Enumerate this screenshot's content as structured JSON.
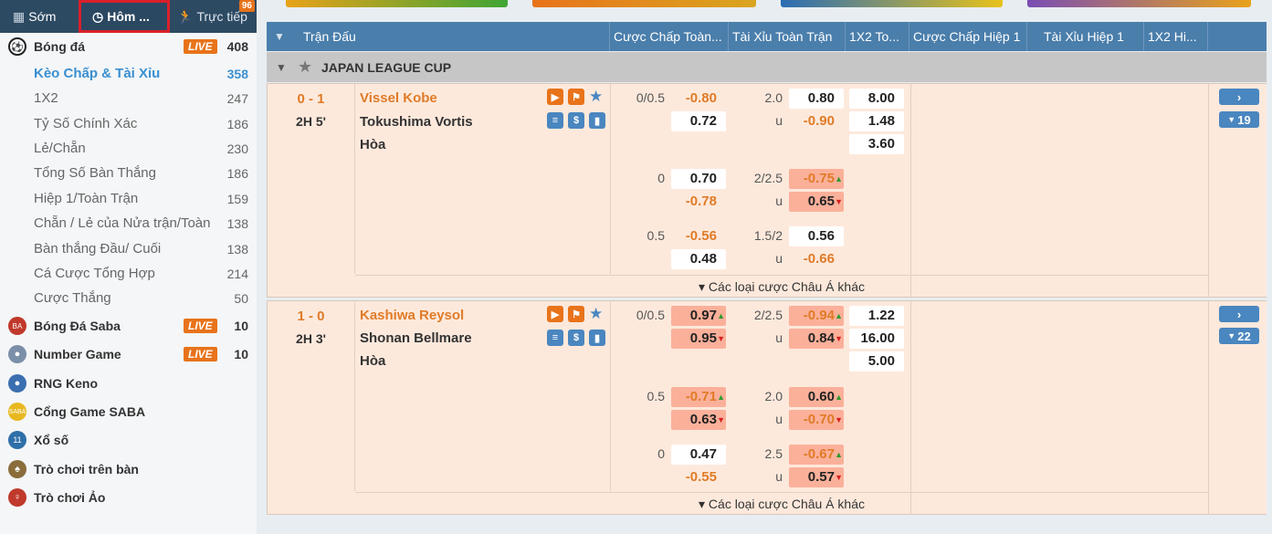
{
  "tabs": {
    "early": "Sớm",
    "today": "Hôm ...",
    "live": "Trực tiếp",
    "live_count": "96"
  },
  "sidebar": {
    "sports": [
      {
        "label": "Bóng đá",
        "live": "LIVE",
        "count": "408"
      },
      {
        "label": "Bóng Đá Saba",
        "live": "LIVE",
        "count": "10"
      },
      {
        "label": "Number Game",
        "live": "LIVE",
        "count": "10"
      },
      {
        "label": "RNG Keno"
      },
      {
        "label": "Cổng Game SABA"
      },
      {
        "label": "Xổ số"
      },
      {
        "label": "Trò chơi trên bàn"
      },
      {
        "label": "Trò chơi Ảo"
      }
    ],
    "subitems": [
      {
        "label": "Kèo Chấp & Tài Xỉu",
        "count": "358"
      },
      {
        "label": "1X2",
        "count": "247"
      },
      {
        "label": "Tỷ Số Chính Xác",
        "count": "186"
      },
      {
        "label": "Lẻ/Chẵn",
        "count": "230"
      },
      {
        "label": "Tổng Số Bàn Thắng",
        "count": "186"
      },
      {
        "label": "Hiệp 1/Toàn Trận",
        "count": "159"
      },
      {
        "label": "Chẵn / Lẻ của Nửa trận/Toàn",
        "count": "138"
      },
      {
        "label": "Bàn thắng Đầu/ Cuối",
        "count": "138"
      },
      {
        "label": "Cá Cược Tổng Hợp",
        "count": "214"
      },
      {
        "label": "Cược Thắng",
        "count": "50"
      }
    ]
  },
  "table": {
    "headers": [
      "Trận Đấu",
      "Cược Chấp Toàn...",
      "Tài Xỉu Toàn Trận",
      "1X2 To...",
      "Cược Chấp Hiệp 1",
      "Tài Xỉu Hiệp 1",
      "1X2 Hi..."
    ],
    "league": "JAPAN LEAGUE CUP",
    "more_label": "▾ Các loại cược Châu Á khác",
    "matches": [
      {
        "score": "0 - 1",
        "time": "2H 5'",
        "home": "Vissel Kobe",
        "away": "Tokushima Vortis",
        "draw": "Hòa",
        "more_count": "19",
        "x12": [
          "8.00",
          "1.48",
          "3.60"
        ],
        "lines": [
          {
            "hdp": "0/0.5",
            "h1": "-0.80",
            "h2": "0.72",
            "ou": "2.0",
            "o1": "0.80",
            "o2": "-0.90",
            "u": "u"
          },
          {
            "hdp": "0",
            "h1": "0.70",
            "h2": "-0.78",
            "ou": "2/2.5",
            "o1": "-0.75",
            "o2": "0.65",
            "u": "u"
          },
          {
            "hdp": "0.5",
            "h1": "-0.56",
            "h2": "0.48",
            "ou": "1.5/2",
            "o1": "0.56",
            "o2": "-0.66",
            "u": "u"
          }
        ]
      },
      {
        "score": "1 - 0",
        "time": "2H 3'",
        "home": "Kashiwa Reysol",
        "away": "Shonan Bellmare",
        "draw": "Hòa",
        "more_count": "22",
        "x12": [
          "1.22",
          "16.00",
          "5.00"
        ],
        "lines": [
          {
            "hdp": "0/0.5",
            "h1": "0.97",
            "h2": "0.95",
            "ou": "2/2.5",
            "o1": "-0.94",
            "o2": "0.84",
            "u": "u"
          },
          {
            "hdp": "0.5",
            "h1": "-0.71",
            "h2": "0.63",
            "ou": "2.0",
            "o1": "0.60",
            "o2": "-0.70",
            "u": "u"
          },
          {
            "hdp": "0",
            "h1": "0.47",
            "h2": "-0.55",
            "ou": "2.5",
            "o1": "-0.67",
            "o2": "0.57",
            "u": "u"
          }
        ]
      }
    ]
  },
  "colors": {
    "header": "#4a7eab",
    "accent": "#e07b27",
    "row": "#fde9dc"
  }
}
